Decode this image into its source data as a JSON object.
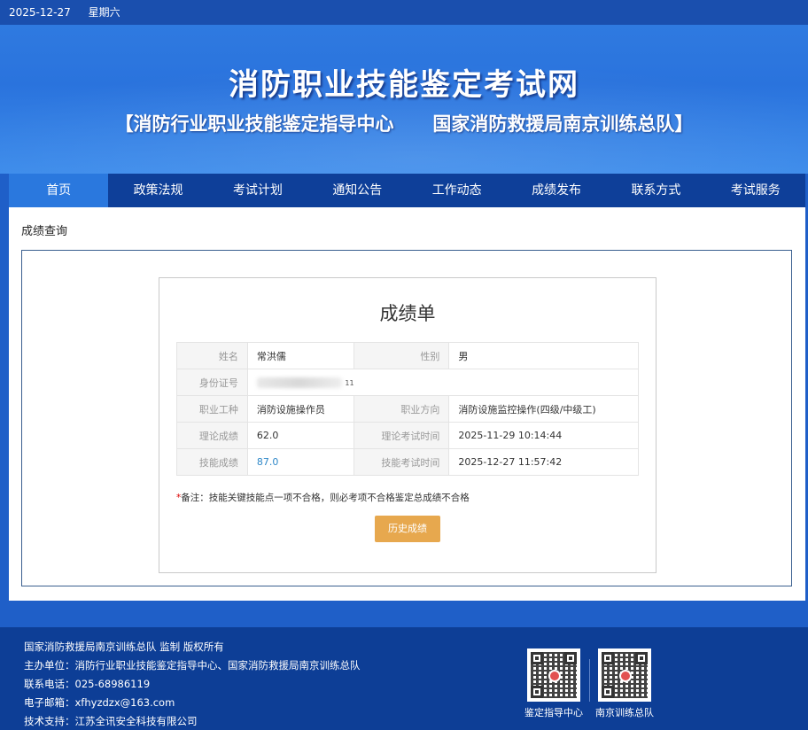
{
  "topbar": {
    "date": "2025-12-27",
    "weekday": "星期六"
  },
  "header": {
    "title": "消防职业技能鉴定考试网",
    "subtitle": "【消防行业职业技能鉴定指导中心      国家消防救援局南京训练总队】"
  },
  "nav": {
    "items": [
      {
        "label": "首页",
        "active": true
      },
      {
        "label": "政策法规"
      },
      {
        "label": "考试计划"
      },
      {
        "label": "通知公告"
      },
      {
        "label": "工作动态"
      },
      {
        "label": "成绩发布"
      },
      {
        "label": "联系方式"
      },
      {
        "label": "考试服务"
      }
    ]
  },
  "breadcrumb": "成绩查询",
  "card": {
    "title": "成绩单",
    "rows": {
      "name_label": "姓名",
      "name_value": "常洪儒",
      "gender_label": "性别",
      "gender_value": "男",
      "id_label": "身份证号",
      "id_value_tail": "11",
      "job_label": "职业工种",
      "job_value": "消防设施操作员",
      "direction_label": "职业方向",
      "direction_value": "消防设施监控操作(四级/中级工)",
      "theory_label": "理论成绩",
      "theory_value": "62.0",
      "theory_time_label": "理论考试时间",
      "theory_time_value": "2025-11-29 10:14:44",
      "skill_label": "技能成绩",
      "skill_value": "87.0",
      "skill_time_label": "技能考试时间",
      "skill_time_value": "2025-12-27 11:57:42"
    },
    "note_star": "*",
    "note": "备注：技能关键技能点一项不合格，则必考项不合格鉴定总成绩不合格",
    "history_button": "历史成绩"
  },
  "footer": {
    "line1": "国家消防救援局南京训练总队 监制 版权所有",
    "line2": "主办单位：消防行业职业技能鉴定指导中心、国家消防救援局南京训练总队",
    "line3": "联系电话：025-68986119",
    "line4": "电子邮箱：xfhyzdzx@163.com",
    "line5": "技术支持：江苏全讯安全科技有限公司",
    "qr1_label": "鉴定指导中心",
    "qr2_label": "南京训练总队"
  },
  "colors": {
    "nav_bg": "#0e3f99",
    "nav_active": "#2a78de",
    "button": "#e7a84e",
    "skill_score": "#2f88c8"
  }
}
